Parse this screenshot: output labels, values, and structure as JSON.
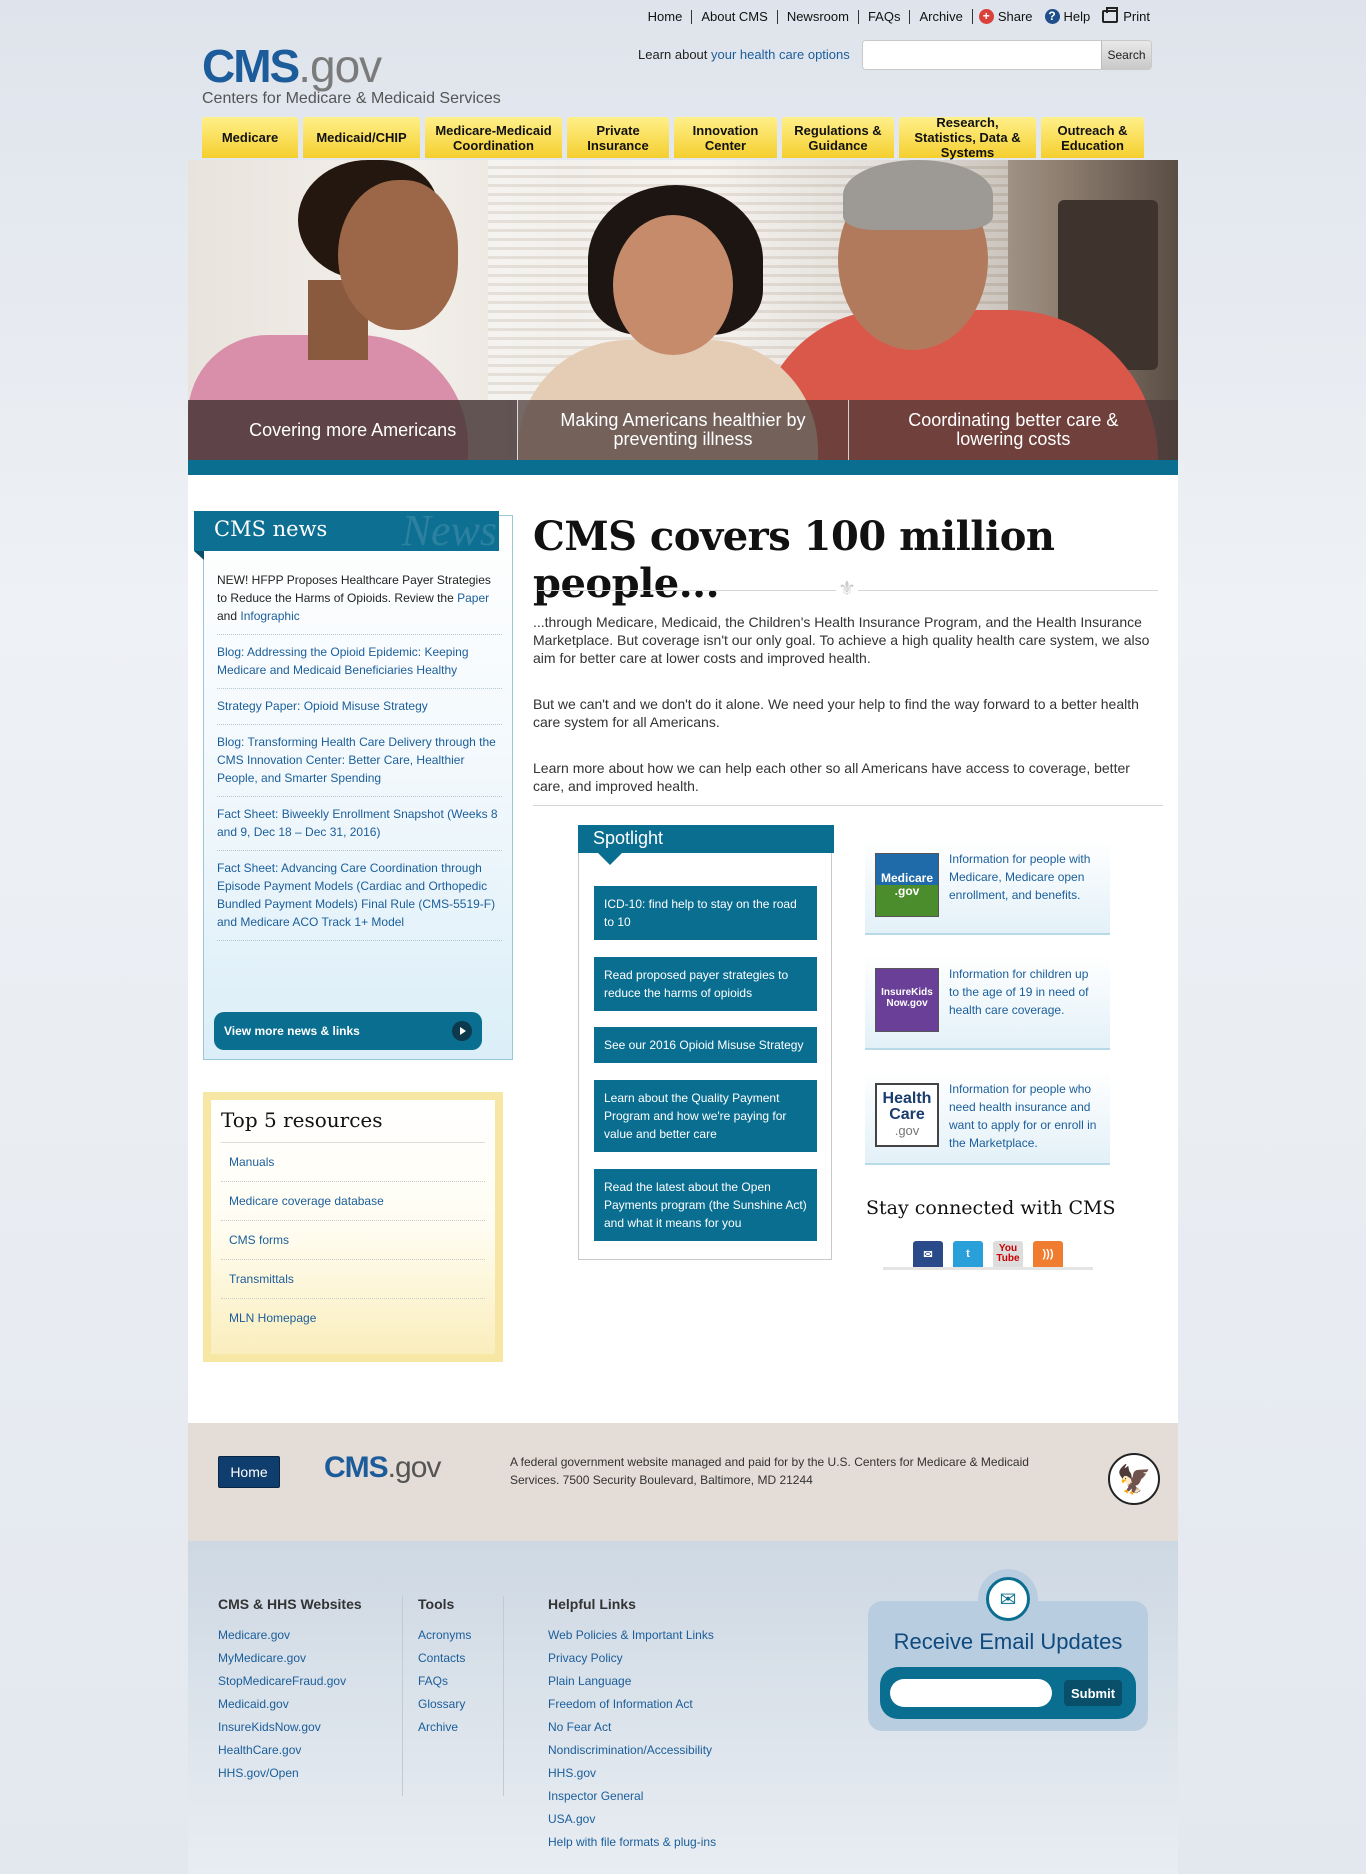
{
  "utility": {
    "links": [
      "Home",
      "About CMS",
      "Newsroom",
      "FAQs",
      "Archive"
    ],
    "share": "Share",
    "help": "Help",
    "print": "Print"
  },
  "logo": {
    "cms": "CMS",
    "gov": ".gov",
    "subtitle": "Centers for Medicare & Medicaid Services"
  },
  "learn": {
    "prefix": "Learn about ",
    "link": "your health care options"
  },
  "search": {
    "placeholder": "",
    "button": "Search"
  },
  "nav": [
    "Medicare",
    "Medicaid/CHIP",
    "Medicare-Medicaid Coordination",
    "Private Insurance",
    "Innovation Center",
    "Regulations & Guidance",
    "Research, Statistics, Data & Systems",
    "Outreach & Education"
  ],
  "hero": {
    "tabs": [
      "Covering more Americans",
      "Making Americans healthier by preventing illness",
      "Coordinating better care & lowering costs"
    ]
  },
  "news": {
    "title": "CMS news",
    "watermark": "News",
    "first_item": {
      "text": "NEW! HFPP Proposes Healthcare Payer Strategies to Reduce the Harms of Opioids. Review the ",
      "link1": "Paper",
      "and": " and ",
      "link2": "Infographic"
    },
    "items": [
      "Blog: Addressing the Opioid Epidemic: Keeping Medicare and Medicaid Beneficiaries Healthy",
      "Strategy Paper: Opioid Misuse Strategy",
      "Blog: Transforming Health Care Delivery through the CMS Innovation Center: Better Care, Healthier People, and Smarter Spending",
      "Fact Sheet: Biweekly Enrollment Snapshot (Weeks 8 and 9, Dec 18 – Dec 31, 2016)",
      "Fact Sheet: Advancing Care Coordination through Episode Payment Models (Cardiac and Orthopedic Bundled Payment Models) Final Rule (CMS-5519-F) and Medicare ACO Track 1+ Model"
    ],
    "button": "View more news & links"
  },
  "top5": {
    "title": "Top 5 resources",
    "items": [
      "Manuals",
      "Medicare coverage database",
      "CMS forms",
      "Transmittals",
      "MLN Homepage"
    ]
  },
  "main": {
    "title": "CMS covers 100 million people...",
    "fleur": "⚜",
    "paragraphs": [
      "...through Medicare, Medicaid, the Children's Health Insurance Program, and the Health Insurance Marketplace. But coverage isn't our only goal. To achieve a high quality health care system, we also aim for better care at lower costs and improved health.",
      "But we can't and we don't do it alone. We need your help to find the way forward to a better health care system for all Americans.",
      "Learn more about how we can help each other so all Americans have access to coverage, better care, and improved health."
    ]
  },
  "spotlight": {
    "title": "Spotlight",
    "items": [
      "ICD-10: find help to stay on the road to 10",
      "Read proposed payer strategies to reduce the harms of opioids",
      "See our 2016 Opioid Misuse Strategy",
      "Learn about the Quality Payment Program and how we're paying for value and better care",
      "Read the latest about the Open Payments program (the Sunshine Act) and what it means for you"
    ]
  },
  "sidecards": [
    {
      "badge_top": "Medicare",
      "badge_bottom": ".gov",
      "text": "Information for people with Medicare, Medicare open enrollment, and benefits."
    },
    {
      "badge_top": "InsureKids",
      "badge_bottom": "Now.gov",
      "text": "Information for children up to the age of 19 in need of health care coverage."
    },
    {
      "badge_top": "Health Care",
      "badge_bottom": ".gov",
      "text": "Information for people who need health insurance and want to apply for or enroll in the Marketplace."
    }
  ],
  "social": {
    "title": "Stay connected with CMS",
    "icons": [
      "email-icon",
      "twitter-icon",
      "youtube-icon",
      "rss-icon"
    ],
    "youtube_label": "You Tube"
  },
  "footer": {
    "home_button": "Home",
    "logo_cms": "CMS",
    "logo_gov": ".gov",
    "text": "A federal government website managed and paid for by the U.S. Centers for Medicare & Medicaid Services. 7500 Security Boulevard, Baltimore, MD 21244",
    "columns": [
      {
        "title": "CMS & HHS Websites",
        "links": [
          "Medicare.gov",
          "MyMedicare.gov",
          "StopMedicareFraud.gov",
          "Medicaid.gov",
          "InsureKidsNow.gov",
          "HealthCare.gov",
          "HHS.gov/Open"
        ]
      },
      {
        "title": "Tools",
        "links": [
          "Acronyms",
          "Contacts",
          "FAQs",
          "Glossary",
          "Archive"
        ]
      },
      {
        "title": "Helpful Links",
        "links": [
          "Web Policies & Important Links",
          "Privacy Policy",
          "Plain Language",
          "Freedom of Information Act",
          "No Fear Act",
          "Nondiscrimination/Accessibility",
          "HHS.gov",
          "Inspector General",
          "USA.gov",
          "Help with file formats & plug-ins"
        ]
      }
    ],
    "email": {
      "title": "Receive Email Updates",
      "placeholder": "",
      "submit": "Submit"
    }
  },
  "colors": {
    "brand_blue": "#1d5c9a",
    "teal": "#0a6e91",
    "nav_yellow": "#f5cf2f",
    "link_blue": "#1b5e9a"
  }
}
